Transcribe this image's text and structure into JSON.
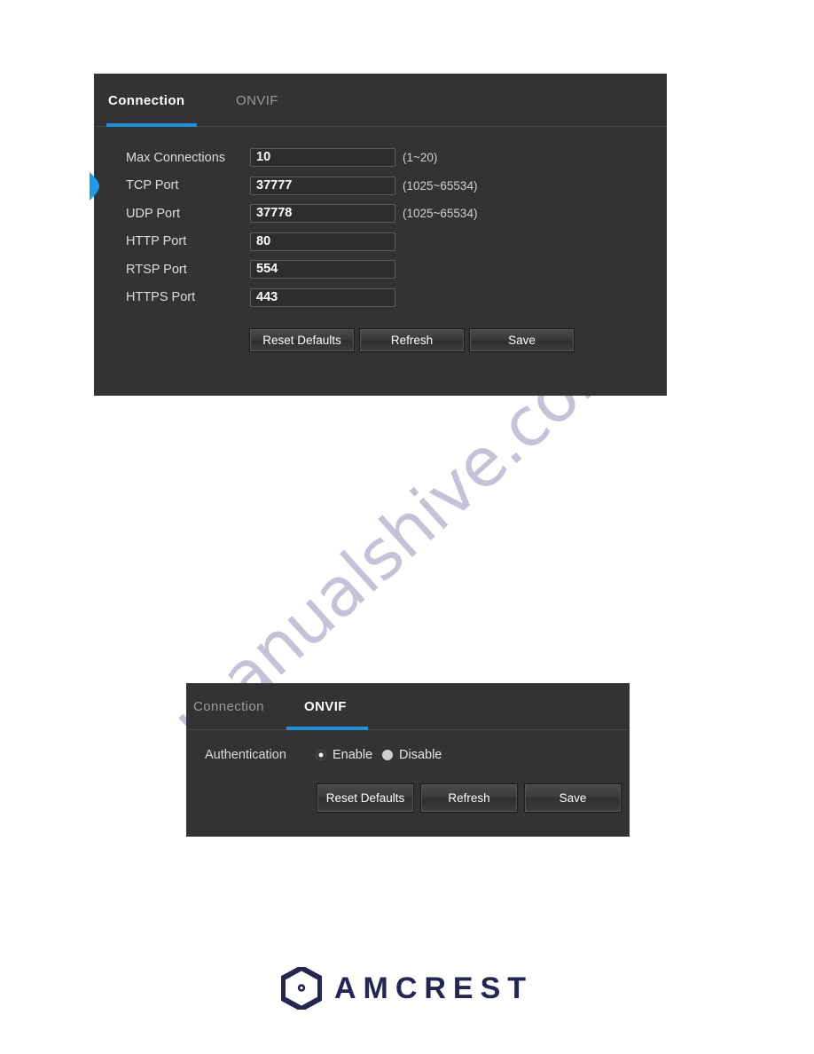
{
  "watermark": {
    "text": "manualshive.com"
  },
  "panels": [
    {
      "id": "connection",
      "tabs": [
        {
          "label": "Connection",
          "active": true
        },
        {
          "label": "ONVIF",
          "active": false
        }
      ],
      "fields": [
        {
          "label": "Max Connections",
          "value": "10",
          "hint": "(1~20)"
        },
        {
          "label": "TCP Port",
          "value": "37777",
          "hint": "(1025~65534)"
        },
        {
          "label": "UDP Port",
          "value": "37778",
          "hint": "(1025~65534)"
        },
        {
          "label": "HTTP Port",
          "value": "80",
          "hint": ""
        },
        {
          "label": "RTSP Port",
          "value": "554",
          "hint": ""
        },
        {
          "label": "HTTPS Port",
          "value": "443",
          "hint": ""
        }
      ],
      "buttons": {
        "reset": "Reset Defaults",
        "refresh": "Refresh",
        "save": "Save"
      }
    },
    {
      "id": "onvif",
      "tabs": [
        {
          "label": "Connection",
          "active": false
        },
        {
          "label": "ONVIF",
          "active": true
        }
      ],
      "authentication": {
        "label": "Authentication",
        "options": [
          {
            "label": "Enable",
            "selected": true
          },
          {
            "label": "Disable",
            "selected": false
          }
        ]
      },
      "buttons": {
        "reset": "Reset Defaults",
        "refresh": "Refresh",
        "save": "Save"
      }
    }
  ],
  "footer": {
    "brand": "AMCREST",
    "logo_icon": "amcrest-hexagon-icon"
  },
  "colors": {
    "accent": "#1e93e0",
    "panel_bg": "#333333",
    "input_bg": "#2d2d2d",
    "watermark": "#3c3a82",
    "brand": "#232552"
  }
}
